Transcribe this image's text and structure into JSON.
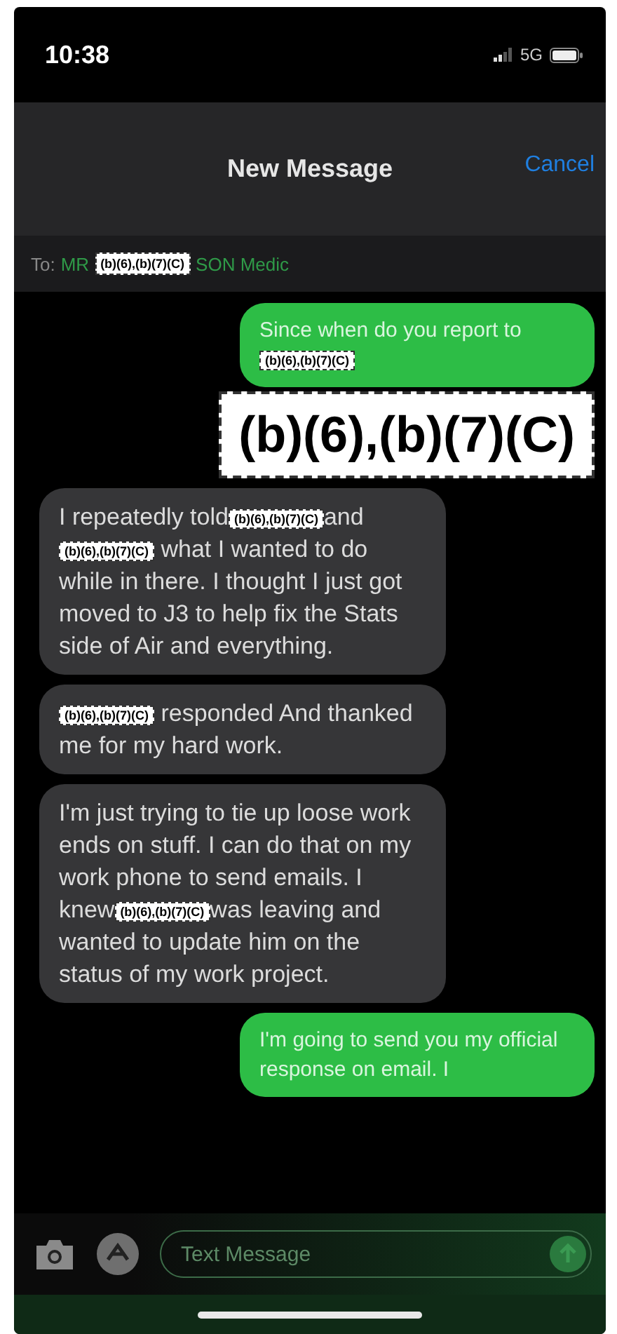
{
  "status_bar": {
    "time": "10:38",
    "network": "5G"
  },
  "header": {
    "title": "New Message",
    "cancel": "Cancel"
  },
  "to_field": {
    "label": "To:",
    "recipient": [
      {
        "kind": "text",
        "text": "MR"
      },
      {
        "kind": "redaction",
        "text": "(b)(6),(b)(7)(C)"
      },
      {
        "kind": "text",
        "text": "SON Medic"
      }
    ]
  },
  "messages": [
    {
      "kind": "sent",
      "parts": [
        {
          "kind": "text",
          "text": "Since when do you report to "
        },
        {
          "kind": "redaction",
          "text": "(b)(6),(b)(7)(C)"
        }
      ]
    },
    {
      "kind": "redaction",
      "text": "(b)(6),(b)(7)(C)"
    },
    {
      "kind": "received",
      "parts": [
        {
          "kind": "text",
          "text": "I repeatedly told"
        },
        {
          "kind": "redaction",
          "text": "(b)(6),(b)(7)(C)"
        },
        {
          "kind": "text",
          "text": "and "
        },
        {
          "kind": "redaction",
          "text": "(b)(6),(b)(7)(C)"
        },
        {
          "kind": "text",
          "text": " what I wanted to do while in there. I thought I just got moved to J3 to help fix the Stats side of Air and everything."
        }
      ]
    },
    {
      "kind": "received",
      "parts": [
        {
          "kind": "redaction",
          "text": "(b)(6),(b)(7)(C)"
        },
        {
          "kind": "text",
          "text": " responded And thanked me for my hard work."
        }
      ]
    },
    {
      "kind": "received",
      "parts": [
        {
          "kind": "text",
          "text": "I'm just trying to tie up loose work ends on stuff. I can do that on my work phone to send emails. I knew"
        },
        {
          "kind": "redaction",
          "text": "(b)(6),(b)(7)(C)"
        },
        {
          "kind": "text",
          "text": "was leaving and wanted to update him on the status of my work project."
        }
      ]
    },
    {
      "kind": "sent",
      "parts": [
        {
          "kind": "text",
          "text": "I'm going to send you my official response on email. I"
        }
      ]
    }
  ],
  "composer": {
    "placeholder": "Text Message"
  }
}
